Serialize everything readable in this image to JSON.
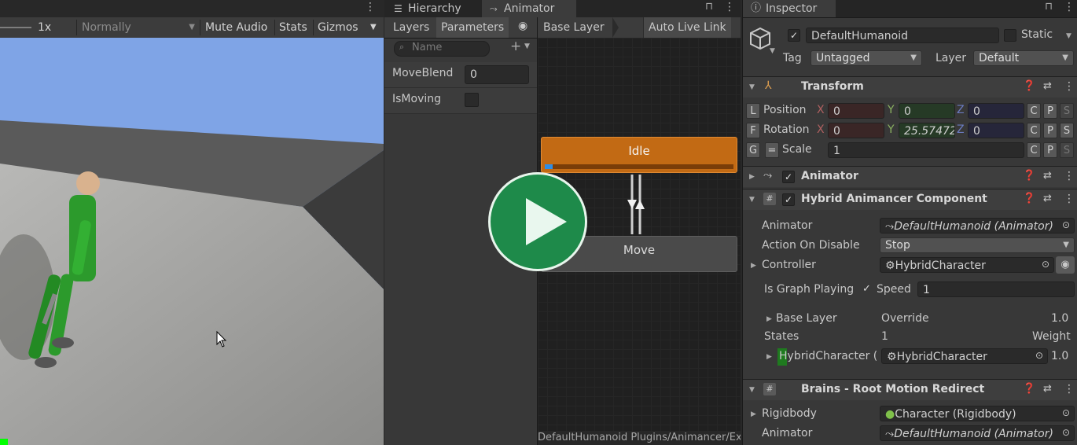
{
  "game": {
    "scale_label": "1x",
    "vsync_dropdown": "Normally",
    "mute_audio": "Mute Audio",
    "stats": "Stats",
    "gizmos": "Gizmos"
  },
  "animator": {
    "tabs": [
      "Hierarchy",
      "Animator"
    ],
    "left_tabs": [
      "Layers",
      "Parameters"
    ],
    "search_placeholder": "Name",
    "parameters": [
      {
        "name": "MoveBlend",
        "value": "0"
      },
      {
        "name": "IsMoving",
        "value": ""
      }
    ],
    "breadcrumb": "Base Layer",
    "auto_live_link": "Auto Live Link",
    "states": {
      "idle": "Idle",
      "move": "Move"
    },
    "footer_path": "DefaultHumanoid Plugins/Animancer/Exar"
  },
  "inspector": {
    "tab": "Inspector",
    "object_name": "DefaultHumanoid",
    "static_label": "Static",
    "tag_label": "Tag",
    "tag_value": "Untagged",
    "layer_label": "Layer",
    "layer_value": "Default",
    "transform": {
      "title": "Transform",
      "position": {
        "label": "Position",
        "x": "0",
        "y": "0",
        "z": "0",
        "lock": "L"
      },
      "rotation": {
        "label": "Rotation",
        "x": "0",
        "y": "25.57472",
        "z": "0",
        "lock": "F"
      },
      "scale": {
        "label": "Scale",
        "value": "1",
        "lock": "G",
        "link": "="
      },
      "cps": [
        "C",
        "P",
        "S"
      ]
    },
    "animator_component": {
      "title": "Animator"
    },
    "hybrid": {
      "title": "Hybrid Animancer Component",
      "animator_label": "Animator",
      "animator_value": "DefaultHumanoid (Animator)",
      "action_on_disable_label": "Action On Disable",
      "action_on_disable_value": "Stop",
      "controller_label": "Controller",
      "controller_value": "HybridCharacter",
      "is_graph_playing_label": "Is Graph Playing",
      "speed_label": "Speed",
      "speed_value": "1",
      "base_layer_label": "Base Layer",
      "base_layer_mode": "Override",
      "base_layer_weight": "1.0",
      "states_label": "States",
      "states_count": "1",
      "weight_label": "Weight",
      "state_name": "HybridCharacter (",
      "state_value": "HybridCharacter",
      "state_weight": "1.0"
    },
    "brains": {
      "title": "Brains - Root Motion Redirect",
      "rigidbody_label": "Rigidbody",
      "rigidbody_value": "Character (Rigidbody)",
      "animator_label": "Animator",
      "animator_value": "DefaultHumanoid (Animator)"
    }
  },
  "colors": {
    "idle_state": "#c26a14",
    "play_button": "#1e8a4a",
    "sky": "#7fa4e6"
  }
}
